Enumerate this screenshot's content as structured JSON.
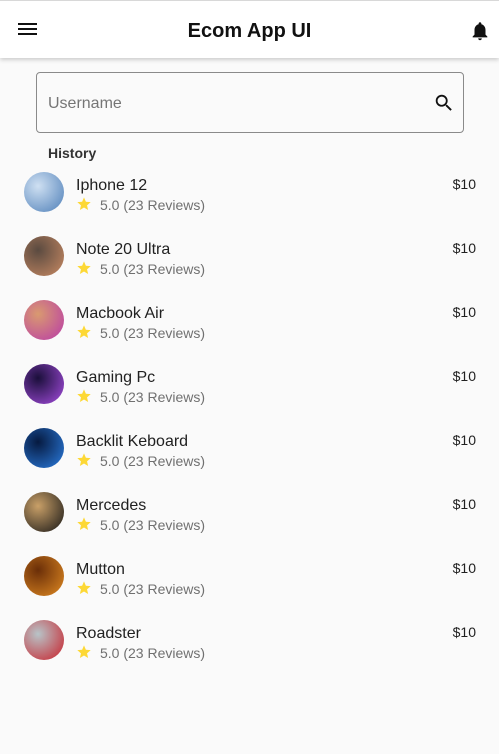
{
  "app_bar": {
    "title": "Ecom App UI",
    "menu_icon": "menu-icon",
    "notification_icon": "bell-icon"
  },
  "search": {
    "placeholder": "Username",
    "value": "",
    "icon": "search-icon"
  },
  "history": {
    "label": "History",
    "items": [
      {
        "name": "Iphone 12",
        "rating": "5.0 (23 Reviews)",
        "price": "$10",
        "thumb_colors": [
          "#cfe0f2",
          "#4e7fb8"
        ]
      },
      {
        "name": "Note 20 Ultra",
        "rating": "5.0 (23 Reviews)",
        "price": "$10",
        "thumb_colors": [
          "#5a4a40",
          "#c98a63"
        ]
      },
      {
        "name": "Macbook Air",
        "rating": "5.0 (23 Reviews)",
        "price": "$10",
        "thumb_colors": [
          "#d99a70",
          "#b93aa8"
        ]
      },
      {
        "name": "Gaming Pc",
        "rating": "5.0 (23 Reviews)",
        "price": "$10",
        "thumb_colors": [
          "#1a0f3a",
          "#a64de0"
        ]
      },
      {
        "name": "Backlit Keboard",
        "rating": "5.0 (23 Reviews)",
        "price": "$10",
        "thumb_colors": [
          "#061a40",
          "#2b7de0"
        ]
      },
      {
        "name": "Mercedes",
        "rating": "5.0 (23 Reviews)",
        "price": "$10",
        "thumb_colors": [
          "#c9a068",
          "#151515"
        ]
      },
      {
        "name": "Mutton",
        "rating": "5.0 (23 Reviews)",
        "price": "$10",
        "thumb_colors": [
          "#6a2e08",
          "#e08a22"
        ]
      },
      {
        "name": "Roadster",
        "rating": "5.0 (23 Reviews)",
        "price": "$10",
        "thumb_colors": [
          "#b8c4c8",
          "#c8202a"
        ]
      }
    ],
    "star_icon": "star-icon",
    "star_color": "#fdd835"
  }
}
